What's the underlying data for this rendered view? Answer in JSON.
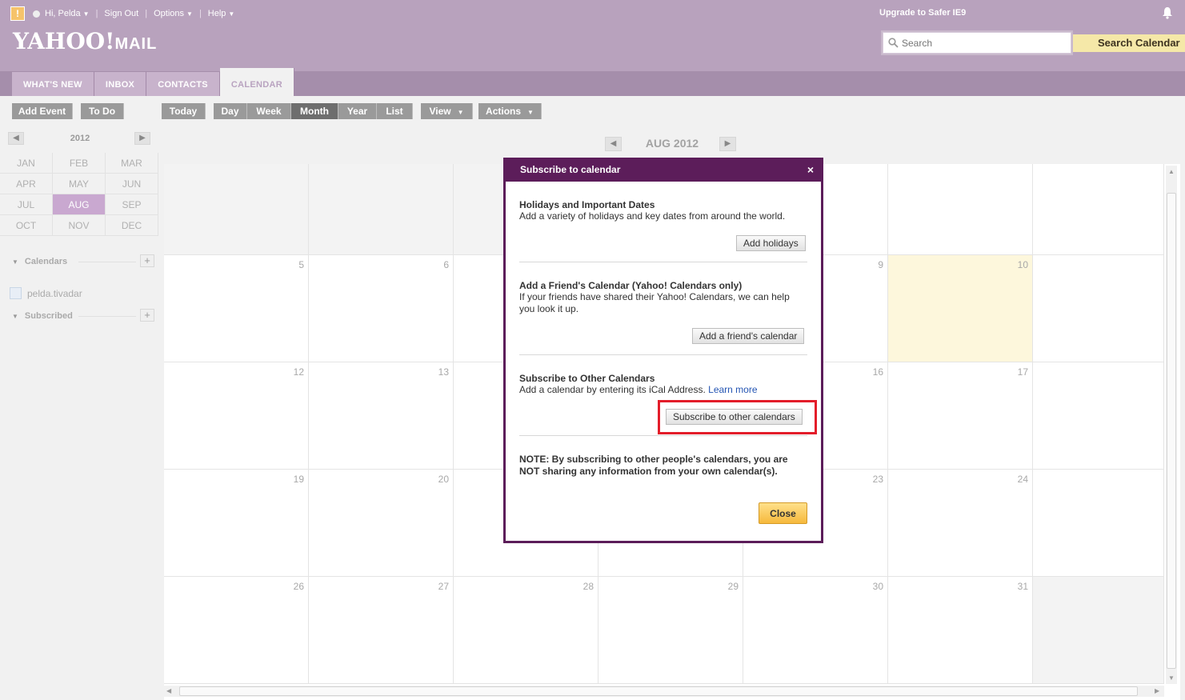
{
  "topbar": {
    "greeting": "Hi, Pelda",
    "sign_out": "Sign Out",
    "options": "Options",
    "help": "Help",
    "upgrade": "Upgrade to Safer IE9"
  },
  "logo": {
    "yahoo": "YAHOO!",
    "mail": "MAIL"
  },
  "search": {
    "placeholder": "Search",
    "button": "Search Calendar"
  },
  "tabs": [
    {
      "label": "WHAT'S NEW"
    },
    {
      "label": "INBOX"
    },
    {
      "label": "CONTACTS"
    },
    {
      "label": "CALENDAR",
      "active": true
    }
  ],
  "toolbar": {
    "add_event": "Add Event",
    "to_do": "To Do",
    "today": "Today",
    "day": "Day",
    "week": "Week",
    "month": "Month",
    "year": "Year",
    "list": "List",
    "view": "View",
    "actions": "Actions"
  },
  "sidebar": {
    "year": "2012",
    "months": [
      "JAN",
      "FEB",
      "MAR",
      "APR",
      "MAY",
      "JUN",
      "JUL",
      "AUG",
      "SEP",
      "OCT",
      "NOV",
      "DEC"
    ],
    "selected_month": "AUG",
    "calendars_label": "Calendars",
    "calendar_item": "pelda.tivadar",
    "subscribed_label": "Subscribed"
  },
  "calendar": {
    "title": "AUG 2012",
    "today": "10",
    "weeks": [
      [
        "",
        "",
        "",
        "",
        "",
        "",
        ""
      ],
      [
        "5",
        "6",
        "",
        "",
        "9",
        "10",
        ""
      ],
      [
        "12",
        "13",
        "",
        "",
        "16",
        "17",
        ""
      ],
      [
        "19",
        "20",
        "",
        "",
        "23",
        "24",
        ""
      ],
      [
        "26",
        "27",
        "28",
        "29",
        "30",
        "31",
        ""
      ]
    ]
  },
  "modal": {
    "title": "Subscribe to calendar",
    "holidays_title": "Holidays and Important Dates",
    "holidays_desc": "Add a variety of holidays and key dates from around the world.",
    "holidays_button": "Add holidays",
    "friend_title": "Add a Friend's Calendar (Yahoo! Calendars only)",
    "friend_desc": "If your friends have shared their Yahoo! Calendars, we can help you look it up.",
    "friend_button": "Add a friend's calendar",
    "other_title": "Subscribe to Other Calendars",
    "other_desc": "Add a calendar by entering its iCal Address.",
    "learn_more": "Learn more",
    "other_button": "Subscribe to other calendars",
    "note": "NOTE: By subscribing to other people's calendars, you are NOT sharing any information from your own calendar(s).",
    "close_button": "Close"
  },
  "colors": {
    "header": "#b8a2bd",
    "modal_frame": "#5c1d5a",
    "highlight": "#e31d2a",
    "today_bg": "#fdf7dc"
  }
}
